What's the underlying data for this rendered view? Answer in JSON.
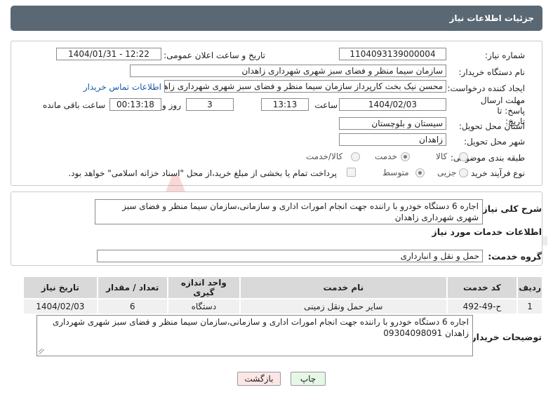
{
  "header": {
    "title": "جزئیات اطلاعات نیاز"
  },
  "form": {
    "need_number_label": "شماره نیاز:",
    "need_number": "1104093139000004",
    "announce_label": "تاریخ و ساعت اعلان عمومی:",
    "announce_value": "1404/01/31 - 12:22",
    "buyer_org_label": "نام دستگاه خریدار:",
    "buyer_org": "سازمان سیما منظر و فضای سبز شهری شهرداری زاهدان",
    "creator_label": "ایجاد کننده درخواست:",
    "creator": "محسن نیک بخت کارپرداز سازمان سیما منظر و فضای سبز شهری شهرداری زاهدان",
    "contact_link": "اطلاعات تماس خریدار",
    "deadline_label": "مهلت ارسال پاسخ: تا تاریخ:",
    "deadline_date": "1404/02/03",
    "time_label": "ساعت",
    "deadline_time": "13:13",
    "days_value": "3",
    "days_label": "روز و",
    "remaining_time": "00:13:18",
    "remaining_label": "ساعت باقی مانده",
    "province_label": "استان محل تحویل:",
    "province": "سیستان و بلوچستان",
    "city_label": "شهر محل تحویل:",
    "city": "زاهدان",
    "category_label": "طبقه بندی موضوعی:",
    "category_options": [
      "کالا",
      "خدمت",
      "کالا/خدمت"
    ],
    "category_selected": "خدمت",
    "process_label": "نوع فرآیند خرید :",
    "process_options": [
      "جزیی",
      "متوسط"
    ],
    "process_selected": "متوسط",
    "payment_note": "پرداخت تمام یا بخشی از مبلغ خرید،از محل \"اسناد خزانه اسلامی\" خواهد بود."
  },
  "summary": {
    "label": "شرح کلی نیاز:",
    "text": "اجاره 6 دستگاه خودرو با راننده جهت انجام امورات اداری و سازمانی،سازمان سیما منظر و فضای سبز شهری شهرداری زاهدان"
  },
  "services": {
    "section_title": "اطلاعات خدمات مورد نیاز",
    "group_label": "گروه خدمت:",
    "group_value": "حمل و نقل و انبارداری",
    "columns": [
      "ردیف",
      "کد خدمت",
      "نام خدمت",
      "واحد اندازه گیری",
      "تعداد / مقدار",
      "تاریخ نیاز"
    ],
    "rows": [
      [
        "1",
        "ح-49-492",
        "سایر حمل ونقل زمینی",
        "دستگاه",
        "6",
        "1404/02/03"
      ]
    ]
  },
  "buyer_notes": {
    "label": "توضیحات خریدار:",
    "text": "اجاره 6 دستگاه خودرو با راننده جهت انجام امورات اداری و سازمانی،سازمان سیما منظر و فضای سبز شهری شهرداری زاهدان 09304098091"
  },
  "buttons": {
    "print": "چاپ",
    "back": "بازگشت"
  },
  "watermark": {
    "text": "AriaTender.neT"
  },
  "colors": {
    "header_bg": "#5a6874",
    "print_btn": "#e6f7e6",
    "back_btn": "#fde6e6",
    "link": "#1a5aa8"
  }
}
